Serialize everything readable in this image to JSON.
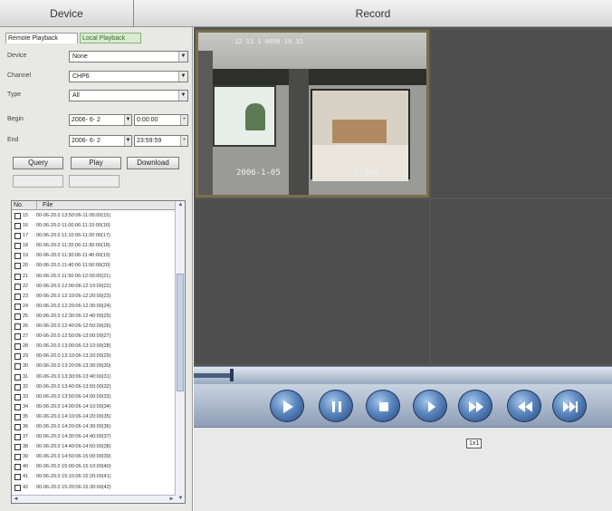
{
  "header": {
    "device_title": "Device",
    "record_title": "Record"
  },
  "tabs": {
    "remote": "Remote Playback",
    "local": "Local Playback"
  },
  "form": {
    "device_label": "Device",
    "device_value": "None",
    "channel_label": "Channel",
    "channel_value": "CHP6",
    "type_label": "Type",
    "type_value": "All",
    "begin_label": "Begin",
    "begin_date": "2006- 6- 2",
    "begin_time": "0:00:00",
    "end_label": "End",
    "end_date": "2006- 6- 2",
    "end_time": "23:59:59"
  },
  "buttons": {
    "query": "Query",
    "play": "Play",
    "download": "Download",
    "disabled_1": "",
    "disabled_2": ""
  },
  "file_list": {
    "col_no": "No.",
    "col_file": "File",
    "rows": [
      {
        "no": "15",
        "file": "00-06-20.0 13:50:06-11:00:00(15)"
      },
      {
        "no": "16",
        "file": "00-06-20.0 11:00:06-11:10:00(16)"
      },
      {
        "no": "17",
        "file": "00-06-20.0 11:10:06-11:20:00(17)"
      },
      {
        "no": "18",
        "file": "00-06-20.0 11:20:06-11:30:00(18)"
      },
      {
        "no": "19",
        "file": "00-06-20.0 11:30:06-11:40:00(19)"
      },
      {
        "no": "20",
        "file": "00-06-20.0 11:40:06-11:50:00(20)"
      },
      {
        "no": "21",
        "file": "00-06-20.0 11:50:06-12:00:00(21)"
      },
      {
        "no": "22",
        "file": "00-06-20.0 12:00:06-12:10:00(22)"
      },
      {
        "no": "23",
        "file": "00-06-20.0 12:10:06-12:20:00(23)"
      },
      {
        "no": "24",
        "file": "00-06-20.0 12:20:06-12:30:00(24)"
      },
      {
        "no": "25",
        "file": "00-06-20.0 12:30:06-12:40:00(25)"
      },
      {
        "no": "26",
        "file": "00-06-20.0 12:40:06-12:50:00(26)"
      },
      {
        "no": "27",
        "file": "00-06-20.0 12:50:06-13:00:00(27)"
      },
      {
        "no": "28",
        "file": "00-06-20.0 13:00:06-13:10:00(28)"
      },
      {
        "no": "29",
        "file": "00-06-20.0 13:10:06-13:20:00(29)"
      },
      {
        "no": "30",
        "file": "00-06-20.0 13:20:06-13:30:00(30)"
      },
      {
        "no": "31",
        "file": "00-06-20.0 13:30:06-13:40:00(31)"
      },
      {
        "no": "32",
        "file": "00-06-20.0 13:40:06-13:50:00(32)"
      },
      {
        "no": "33",
        "file": "00-06-20.0 13:50:06-14:00:00(33)"
      },
      {
        "no": "34",
        "file": "00-06-20.0 14:00:06-14:10:00(34)"
      },
      {
        "no": "35",
        "file": "00-06-20.0 14:10:06-14:20:00(35)"
      },
      {
        "no": "36",
        "file": "00-06-20.0 14:20:06-14:30:00(36)"
      },
      {
        "no": "37",
        "file": "00-06-20.0 14:30:06-14:40:00(37)"
      },
      {
        "no": "38",
        "file": "00-06-20.0 14:40:06-14:50:00(38)"
      },
      {
        "no": "39",
        "file": "00-06-20.0 14:50:06-15:00:00(39)"
      },
      {
        "no": "40",
        "file": "00-06-20.0 15:00:06-15:10:00(40)"
      },
      {
        "no": "41",
        "file": "00-06-20.0 15:10:06-15:20:00(41)"
      },
      {
        "no": "42",
        "file": "00-06-20.0 15:20:06-15:30:00(42)"
      }
    ]
  },
  "video": {
    "osd_top": "12  11  1  0058  10  32",
    "osd_date": "2006-1-05",
    "osd_time": "7:39A"
  },
  "playback": {
    "progress": 0.09
  },
  "controls": {
    "icons": [
      "play-icon",
      "pause-icon",
      "stop-icon",
      "step-forward-icon",
      "fast-forward-icon",
      "rewind-icon",
      "next-icon"
    ],
    "accent": "#4a76ad"
  },
  "status": {
    "text": "1x1"
  }
}
